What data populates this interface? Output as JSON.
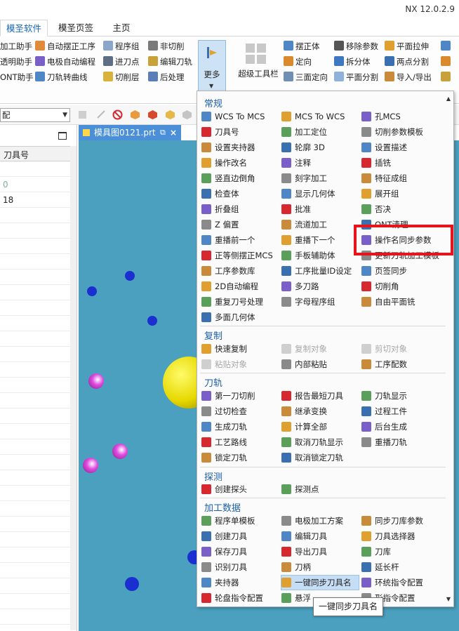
{
  "app": {
    "version": "NX 12.0.2.9"
  },
  "ribbon_tabs": [
    {
      "label": "模圣软件",
      "active": true
    },
    {
      "label": "模圣页签",
      "active": false
    },
    {
      "label": "主页",
      "active": false
    }
  ],
  "ribbon": {
    "col1": [
      "加工助手",
      "透明助手",
      "ONT助手"
    ],
    "col2": [
      "自动摆正工序",
      "电极自动编程",
      "刀轨转曲线"
    ],
    "col3": [
      "程序组",
      "进刀点",
      "切削层"
    ],
    "col4": [
      "非切削",
      "编辑刀轨",
      "后处理"
    ],
    "more": "更多",
    "super_toolbar": "超级工具栏",
    "col5": [
      "摆正体",
      "定向",
      "三面定向"
    ],
    "col6": [
      "移除参数",
      "拆分体",
      "平面分割"
    ],
    "col7": [
      "平面拉伸",
      "两点分割",
      "导入/导出"
    ]
  },
  "toolbar": {
    "filter_value": "配"
  },
  "navigator": {
    "column_header": "刀具号",
    "rows": [
      "",
      "0",
      "18",
      "",
      "",
      "",
      "",
      "",
      "",
      "",
      "",
      "",
      "",
      "",
      "",
      "",
      "",
      "",
      "",
      "",
      "",
      "",
      "",
      "",
      "",
      "",
      "",
      "",
      "",
      ""
    ]
  },
  "graphics_tab": {
    "name": "模具图0121.prt",
    "close": "×"
  },
  "menu": {
    "sections": {
      "general": "常规",
      "copy": "复制",
      "toolpath": "刀轨",
      "probe": "探测",
      "machining_data": "加工数据"
    },
    "general": [
      [
        "WCS To MCS",
        "MCS To WCS",
        "孔MCS"
      ],
      [
        "刀具号",
        "加工定位",
        "切削参数模板"
      ],
      [
        "设置夹持器",
        "轮廓 3D",
        "设置描述"
      ],
      [
        "操作改名",
        "注释",
        "插铣"
      ],
      [
        "竖直边倒角",
        "刻字加工",
        "特征成组"
      ],
      [
        "检查体",
        "显示几何体",
        "展开组"
      ],
      [
        "折叠组",
        "批准",
        "否决"
      ],
      [
        "Z 偏置",
        "流道加工",
        "ONT清理"
      ],
      [
        "重播前一个",
        "重播下一个",
        "操作名同步参数"
      ],
      [
        "正等侧摆正MCS",
        "手板辅助体",
        "更新刀轨加工模板"
      ],
      [
        "工序参数库",
        "工序批量ID设定",
        "页签同步"
      ],
      [
        "2D自动编程",
        "多刀路",
        "切削角"
      ],
      [
        "重复刀号处理",
        "字母程序组",
        "自由平面铣"
      ],
      [
        "多面几何体",
        "",
        ""
      ]
    ],
    "copy": [
      [
        "快速复制",
        "复制对象",
        "剪切对象"
      ],
      [
        "粘贴对象",
        "内部粘贴",
        "工序配数"
      ]
    ],
    "toolpath": [
      [
        "第一刀切削",
        "报告最短刀具",
        "刀轨显示"
      ],
      [
        "过切检查",
        "继承变换",
        "过程工件"
      ],
      [
        "生成刀轨",
        "计算全部",
        "后台生成"
      ],
      [
        "工艺路线",
        "取消刀轨显示",
        "重播刀轨"
      ],
      [
        "锁定刀轨",
        "取消锁定刀轨",
        ""
      ]
    ],
    "probe": [
      [
        "创建探头",
        "探测点",
        ""
      ]
    ],
    "machining_data": [
      [
        "程序单模板",
        "电极加工方案",
        "同步刀库参数"
      ],
      [
        "创建刀具",
        "编辑刀具",
        "刀具选择器"
      ],
      [
        "保存刀具",
        "导出刀具",
        "刀库"
      ],
      [
        "识别刀具",
        "刀柄",
        "延长杆"
      ],
      [
        "夹持器",
        "一键同步刀具名",
        "环统指令配置"
      ],
      [
        "轮盘指令配置",
        "悬浮",
        "形指令配置"
      ]
    ]
  },
  "tooltip": "一键同步刀具名",
  "colors": {
    "accent": "#1a67b3",
    "highlight_box": "#e8141c",
    "graphics_bg": "#4aa0be",
    "menu_hover": "#c5def5"
  }
}
